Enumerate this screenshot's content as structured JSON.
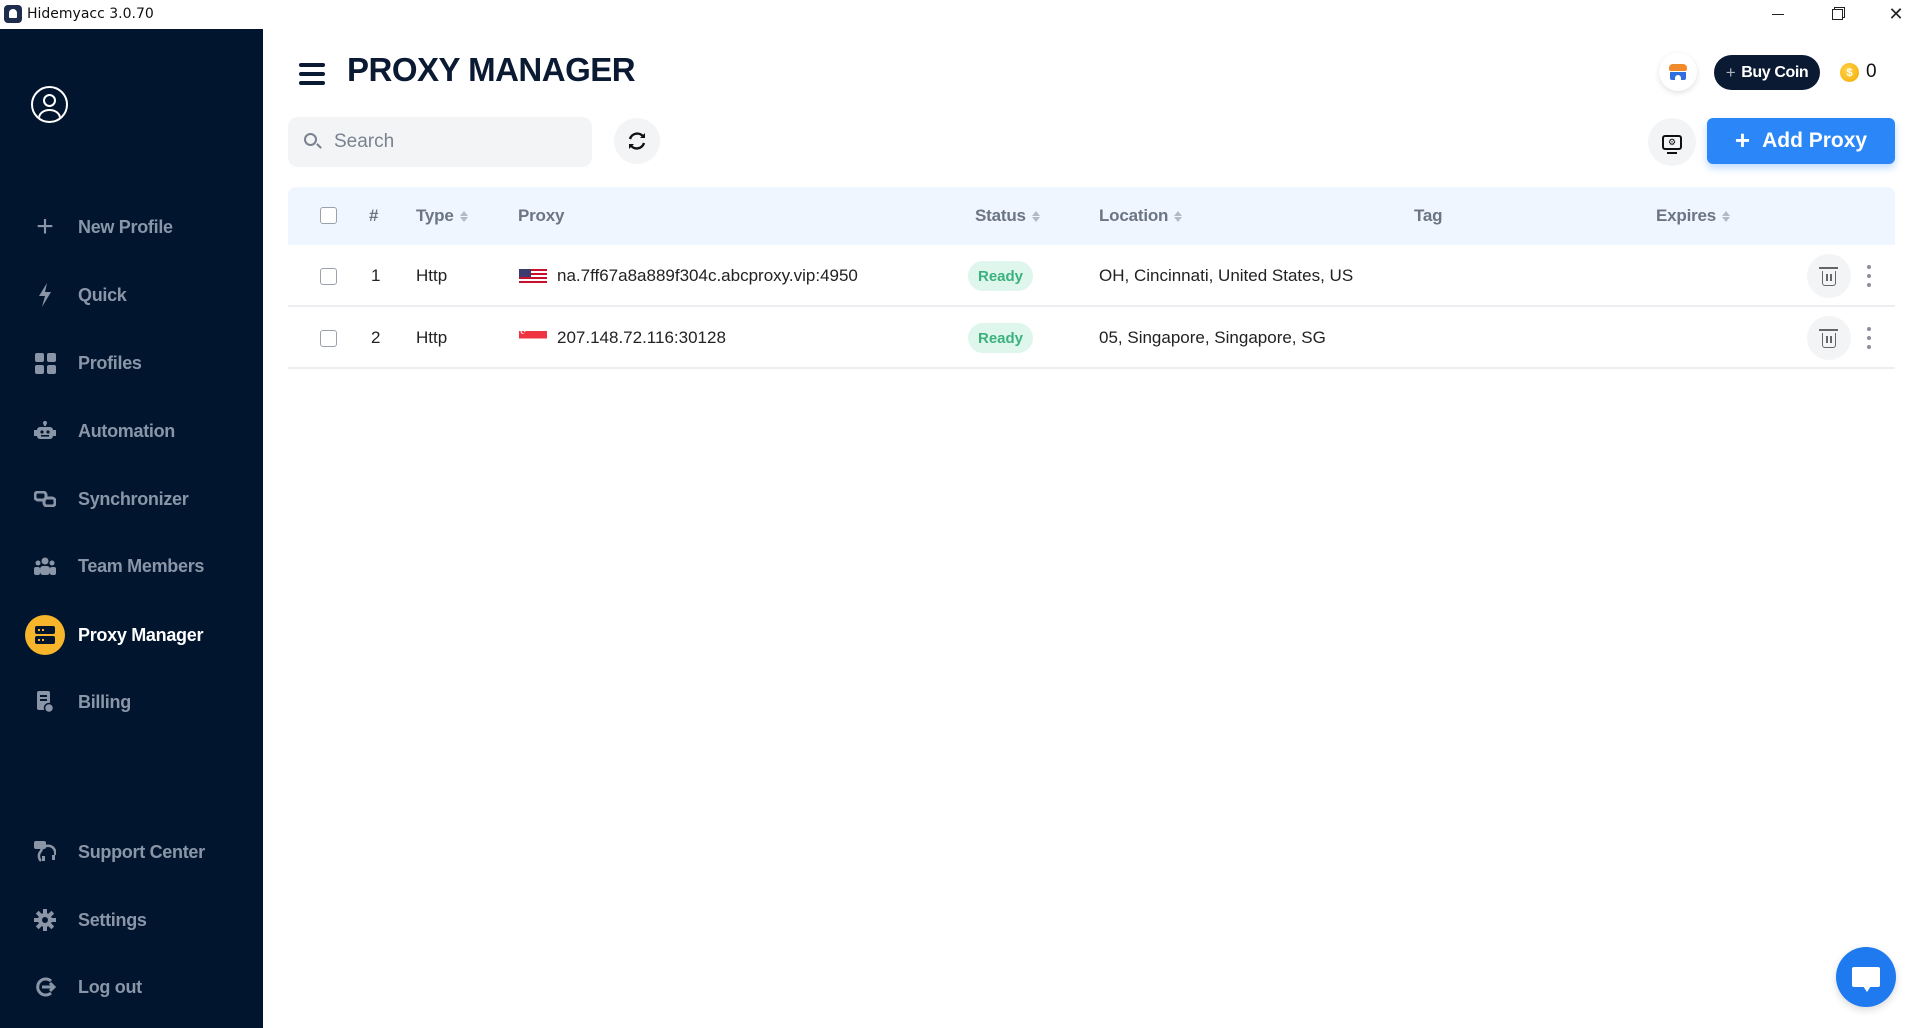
{
  "window": {
    "title": "Hidemyacc 3.0.70",
    "controls": {
      "minimize": "—",
      "maximize": "❐",
      "close": "✕"
    }
  },
  "sidebar": {
    "items": [
      {
        "label": "New Profile",
        "icon": "plus-icon",
        "glyph": "+"
      },
      {
        "label": "Quick",
        "icon": "lightning-icon",
        "glyph": "⚡"
      },
      {
        "label": "Profiles",
        "icon": "grid-icon",
        "glyph": ""
      },
      {
        "label": "Automation",
        "icon": "robot-icon",
        "glyph": "🤖"
      },
      {
        "label": "Synchronizer",
        "icon": "sync-link-icon",
        "glyph": "⛓"
      },
      {
        "label": "Team Members",
        "icon": "team-icon",
        "glyph": "👥"
      },
      {
        "label": "Proxy Manager",
        "icon": "server-icon",
        "glyph": "",
        "active": true
      },
      {
        "label": "Billing",
        "icon": "billing-icon",
        "glyph": "🧾"
      }
    ],
    "bottom_items": [
      {
        "label": "Support Center",
        "icon": "support-icon",
        "glyph": "🎧"
      },
      {
        "label": "Settings",
        "icon": "gear-icon",
        "glyph": "⚙"
      },
      {
        "label": "Log out",
        "icon": "logout-icon",
        "glyph": "⏻"
      }
    ],
    "active_color": "#f6b52a"
  },
  "header": {
    "title": "PROXY MANAGER",
    "buy_coin_label": "Buy Coin",
    "buy_coin_plus": "+",
    "coin_symbol": "$",
    "coin_count": "0"
  },
  "toolbar": {
    "search_placeholder": "Search",
    "refresh_glyph": "⟳",
    "screen_glyph": "⚙",
    "add_proxy_label": "Add Proxy",
    "add_proxy_plus": "+"
  },
  "table": {
    "columns": {
      "index": "#",
      "type": "Type",
      "proxy": "Proxy",
      "status": "Status",
      "location": "Location",
      "tag": "Tag",
      "expires": "Expires"
    },
    "rows": [
      {
        "index": "1",
        "type": "Http",
        "country": "US",
        "proxy": "na.7ff67a8a889f304c.abcproxy.vip:4950",
        "status": "Ready",
        "location": "OH, Cincinnati, United States, US",
        "tag": "",
        "expires": ""
      },
      {
        "index": "2",
        "type": "Http",
        "country": "SG",
        "proxy": "207.148.72.116:30128",
        "status": "Ready",
        "location": "05, Singapore, Singapore, SG",
        "tag": "",
        "expires": ""
      }
    ]
  },
  "colors": {
    "sidebar_bg": "#02152e",
    "accent_blue": "#2b87f7",
    "status_ready_bg": "#dff6ec",
    "status_ready_text": "#3bb27c",
    "table_header_bg": "#eff6ff"
  }
}
